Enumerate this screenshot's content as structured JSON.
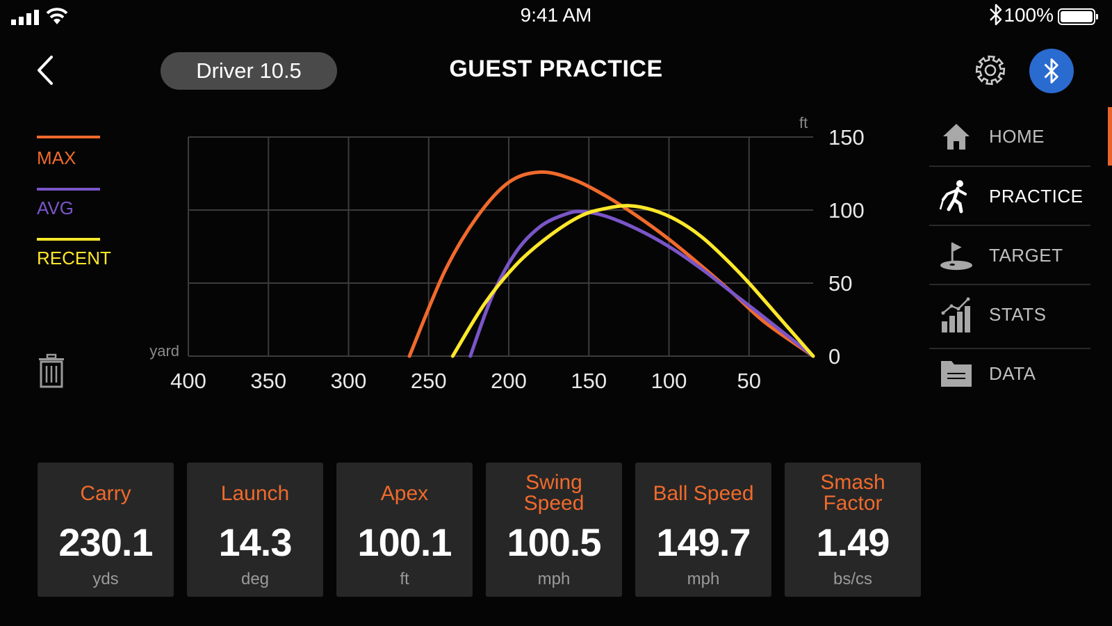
{
  "status_bar": {
    "time": "9:41 AM",
    "battery_pct": "100%",
    "icons": [
      "signal-icon",
      "wifi-icon",
      "bluetooth-icon",
      "battery-icon"
    ]
  },
  "header": {
    "club": "Driver 10.5",
    "title": "GUEST PRACTICE",
    "icons": [
      "back-icon",
      "gear-icon",
      "bluetooth-icon"
    ]
  },
  "legend": [
    {
      "label": "MAX",
      "color": "#f06a2c"
    },
    {
      "label": "AVG",
      "color": "#7a55c8"
    },
    {
      "label": "RECENT",
      "color": "#ffe82a"
    }
  ],
  "chart_data": {
    "type": "line",
    "xlabel": "yard",
    "ylabel": "ft",
    "x_ticks": [
      "400",
      "350",
      "300",
      "250",
      "200",
      "150",
      "100",
      "50"
    ],
    "y_ticks": [
      "150",
      "100",
      "50",
      "0"
    ],
    "xlim": [
      400,
      10
    ],
    "ylim": [
      0,
      150
    ],
    "grid": true,
    "series": [
      {
        "name": "MAX",
        "color": "#f06a2c",
        "x": [
          262,
          240,
          220,
          200,
          180,
          160,
          140,
          120,
          100,
          80,
          60,
          40,
          10
        ],
        "y": [
          0,
          58,
          95,
          119,
          126,
          121,
          110,
          96,
          80,
          62,
          43,
          23,
          0
        ]
      },
      {
        "name": "AVG",
        "color": "#7a55c8",
        "x": [
          224,
          210,
          195,
          180,
          165,
          155,
          140,
          120,
          100,
          80,
          60,
          40,
          10
        ],
        "y": [
          0,
          42,
          72,
          89,
          97,
          99,
          96,
          87,
          75,
          60,
          43,
          26,
          0
        ]
      },
      {
        "name": "RECENT",
        "color": "#ffe82a",
        "x": [
          235,
          215,
          195,
          175,
          155,
          140,
          125,
          110,
          95,
          80,
          65,
          50,
          30,
          10
        ],
        "y": [
          0,
          36,
          63,
          82,
          96,
          101,
          103,
          100,
          93,
          82,
          67,
          50,
          25,
          0
        ]
      }
    ]
  },
  "trash_icon": "trash-icon",
  "nav": [
    {
      "label": "HOME",
      "icon": "home-icon",
      "active": false
    },
    {
      "label": "PRACTICE",
      "icon": "golfer-swing-icon",
      "active": true
    },
    {
      "label": "TARGET",
      "icon": "flag-green-icon",
      "active": false
    },
    {
      "label": "STATS",
      "icon": "bar-chart-icon",
      "active": false
    },
    {
      "label": "DATA",
      "icon": "folder-icon",
      "active": false
    }
  ],
  "metrics": [
    {
      "title_line1": "Carry",
      "title_line2": "",
      "value": "230.1",
      "unit": "yds"
    },
    {
      "title_line1": "Launch",
      "title_line2": "",
      "value": "14.3",
      "unit": "deg"
    },
    {
      "title_line1": "Apex",
      "title_line2": "",
      "value": "100.1",
      "unit": "ft"
    },
    {
      "title_line1": "Swing",
      "title_line2": "Speed",
      "value": "100.5",
      "unit": "mph"
    },
    {
      "title_line1": "Ball Speed",
      "title_line2": "",
      "value": "149.7",
      "unit": "mph"
    },
    {
      "title_line1": "Smash",
      "title_line2": "Factor",
      "value": "1.49",
      "unit": "bs/cs"
    }
  ]
}
